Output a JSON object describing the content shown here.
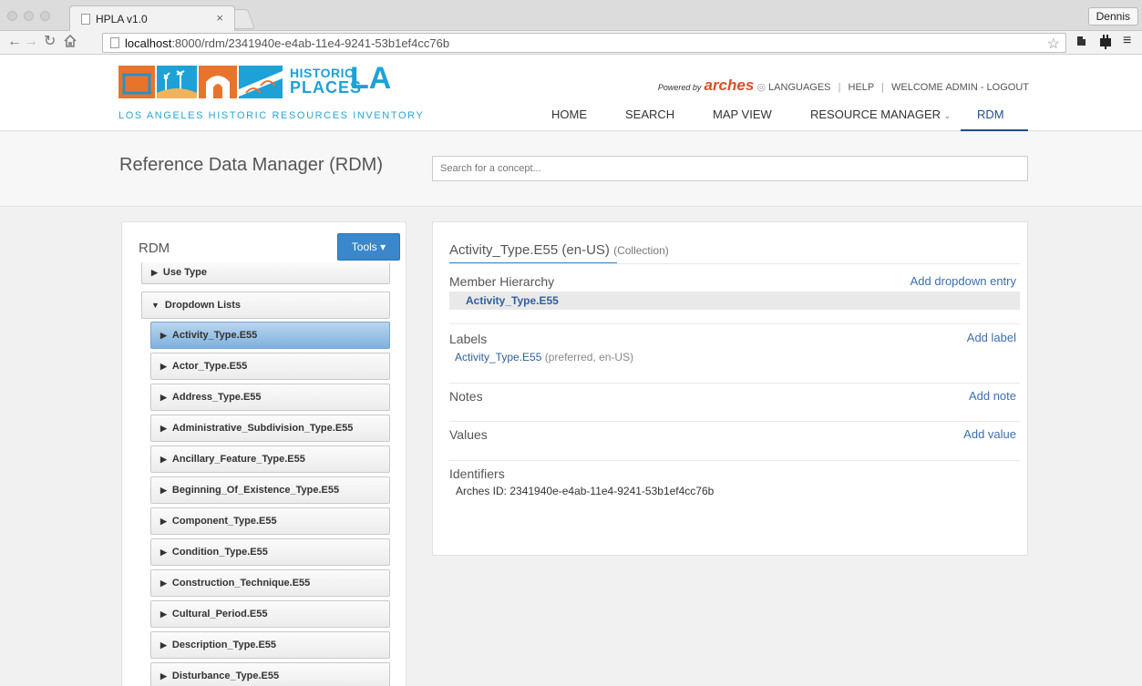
{
  "browser": {
    "tab_title": "HPLA v1.0",
    "tab_close": "×",
    "profile": "Dennis",
    "url_host": "localhost",
    "url_path": ":8000/rdm/2341940e-e4ab-11e4-9241-53b1ef4cc76b",
    "icons": [
      "back-icon",
      "forward-icon",
      "reload-icon",
      "home-icon",
      "star-icon",
      "extension-icon",
      "menu-icon"
    ]
  },
  "header": {
    "logo_line1": "HISTORIC",
    "logo_line2": "PLACES",
    "logo_la": "LA",
    "tagline": "LOS ANGELES HISTORIC RESOURCES INVENTORY",
    "powered_by": "Powered by",
    "arches": "arches",
    "languages": "LANGUAGES",
    "help": "HELP",
    "welcome": "WELCOME ADMIN - LOGOUT",
    "nav": {
      "home": "HOME",
      "search": "SEARCH",
      "map": "MAP VIEW",
      "resource_manager": "RESOURCE MANAGER",
      "rdm": "RDM"
    },
    "colors": {
      "brand_blue": "#1ea1d6",
      "orange": "#e8742c",
      "nav_active": "#1f4f8f"
    }
  },
  "titlebar": {
    "title": "Reference Data Manager (RDM)",
    "search_placeholder": "Search for a concept..."
  },
  "left_panel": {
    "title": "RDM",
    "tools_label": "Tools",
    "items": {
      "use_type": "Use Type",
      "dropdown_lists": "Dropdown Lists",
      "activity_type": "Activity_Type.E55",
      "actor_type": "Actor_Type.E55",
      "address_type": "Address_Type.E55",
      "admin_subdivision": "Administrative_Subdivision_Type.E55",
      "ancillary_feature": "Ancillary_Feature_Type.E55",
      "beginning_of_existence": "Beginning_Of_Existence_Type.E55",
      "component_type": "Component_Type.E55",
      "condition_type": "Condition_Type.E55",
      "construction_technique": "Construction_Technique.E55",
      "cultural_period": "Cultural_Period.E55",
      "description_type": "Description_Type.E55",
      "disturbance_type": "Disturbance_Type.E55"
    },
    "selected": "Activity_Type.E55"
  },
  "right_panel": {
    "heading": "Activity_Type.E55 (en-US)",
    "heading_note": "(Collection)",
    "member_hierarchy": "Member Hierarchy",
    "add_dropdown_entry": "Add dropdown entry",
    "hierarchy_item": "Activity_Type.E55",
    "labels": "Labels",
    "add_label": "Add label",
    "label_value": "Activity_Type.E55",
    "label_meta": "(preferred, en-US)",
    "notes": "Notes",
    "add_note": "Add note",
    "values": "Values",
    "add_value": "Add value",
    "identifiers": "Identifiers",
    "arches_id": "Arches ID: 2341940e-e4ab-11e4-9241-53b1ef4cc76b"
  }
}
